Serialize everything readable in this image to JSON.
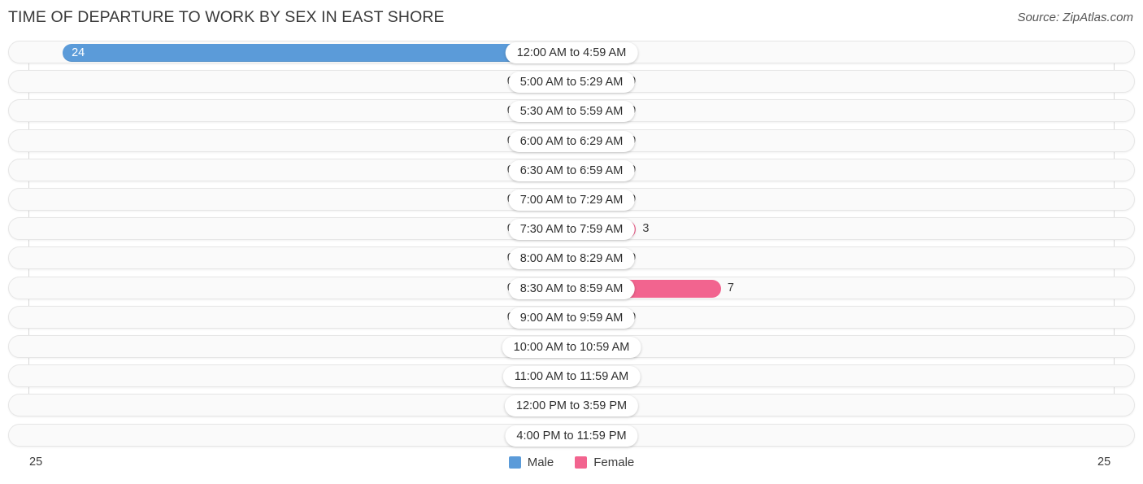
{
  "header": {
    "title": "TIME OF DEPARTURE TO WORK BY SEX IN EAST SHORE",
    "source": "Source: ZipAtlas.com"
  },
  "axis": {
    "left_tick": "25",
    "right_tick": "25"
  },
  "legend": {
    "items": [
      {
        "label": "Male",
        "color": "#5b9bd9"
      },
      {
        "label": "Female",
        "color": "#f2648f"
      }
    ]
  },
  "colors": {
    "male": "#5b9bd9",
    "male_zero": "#aac8ea",
    "female": "#f2648f",
    "female_zero": "#f7a8c2",
    "row_bg": "#fafafa",
    "row_border": "#e6e6e6",
    "title": "#3a3a3a"
  },
  "chart_data": {
    "type": "bar",
    "orientation": "horizontal-diverging",
    "title": "TIME OF DEPARTURE TO WORK BY SEX IN EAST SHORE",
    "xlabel": "",
    "ylabel": "",
    "xlim": [
      25,
      25
    ],
    "axis_max": 25,
    "grid": false,
    "legend_position": "bottom-center",
    "categories": [
      "12:00 AM to 4:59 AM",
      "5:00 AM to 5:29 AM",
      "5:30 AM to 5:59 AM",
      "6:00 AM to 6:29 AM",
      "6:30 AM to 6:59 AM",
      "7:00 AM to 7:29 AM",
      "7:30 AM to 7:59 AM",
      "8:00 AM to 8:29 AM",
      "8:30 AM to 8:59 AM",
      "9:00 AM to 9:59 AM",
      "10:00 AM to 10:59 AM",
      "11:00 AM to 11:59 AM",
      "12:00 PM to 3:59 PM",
      "4:00 PM to 11:59 PM"
    ],
    "series": [
      {
        "name": "Male",
        "values": [
          24,
          0,
          0,
          0,
          0,
          0,
          0,
          0,
          0,
          0,
          0,
          0,
          0,
          0
        ]
      },
      {
        "name": "Female",
        "values": [
          0,
          0,
          0,
          0,
          0,
          0,
          3,
          0,
          7,
          0,
          0,
          0,
          0,
          0
        ]
      }
    ],
    "male_labels": [
      "24",
      "0",
      "0",
      "0",
      "0",
      "0",
      "0",
      "0",
      "0",
      "0",
      "0",
      "0",
      "0",
      "0"
    ],
    "female_labels": [
      "0",
      "0",
      "0",
      "0",
      "0",
      "0",
      "3",
      "0",
      "7",
      "0",
      "0",
      "0",
      "0",
      "0"
    ]
  }
}
